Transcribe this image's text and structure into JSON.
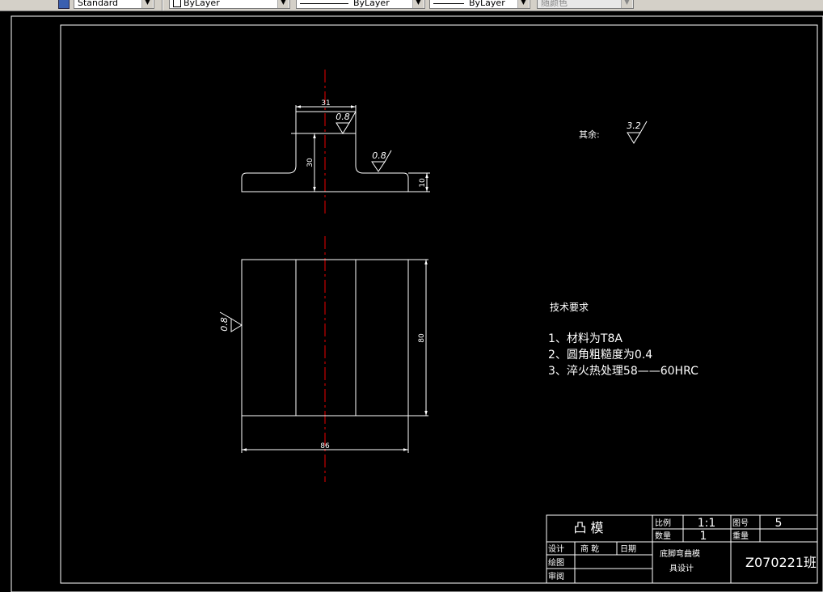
{
  "toolbar": {
    "textstyle": "Standard",
    "layer": "ByLayer",
    "linetype": "ByLayer",
    "lineweight": "ByLayer",
    "plotstyle": "随颜色"
  },
  "drawing": {
    "dims": {
      "top_width": "31",
      "top_height": "30",
      "flange_height": "10",
      "front_height": "80",
      "front_width": "86"
    },
    "surface_marks": {
      "top": "0.8",
      "shoulder": "0.8",
      "side": "0.8"
    },
    "rest_note": {
      "label": "其余:",
      "value": "3.2"
    },
    "tech_req": {
      "title": "技术要求",
      "items": [
        "1、材料为T8A",
        "2、圆角粗糙度为0.4",
        "3、淬火热处理58——60HRC"
      ]
    }
  },
  "title_block": {
    "part_name": "凸 模",
    "scale_label": "比例",
    "scale": "1:1",
    "drawing_no_label": "图号",
    "drawing_no": "5",
    "qty_label": "数量",
    "qty": "1",
    "weight_label": "重量",
    "design_label": "设计",
    "designer": "商 乾",
    "date_label": "日期",
    "drawn_label": "绘图",
    "review_label": "审阅",
    "project_line1": "底脚弯曲模",
    "project_line2": "具设计",
    "code": "Z070221班"
  }
}
